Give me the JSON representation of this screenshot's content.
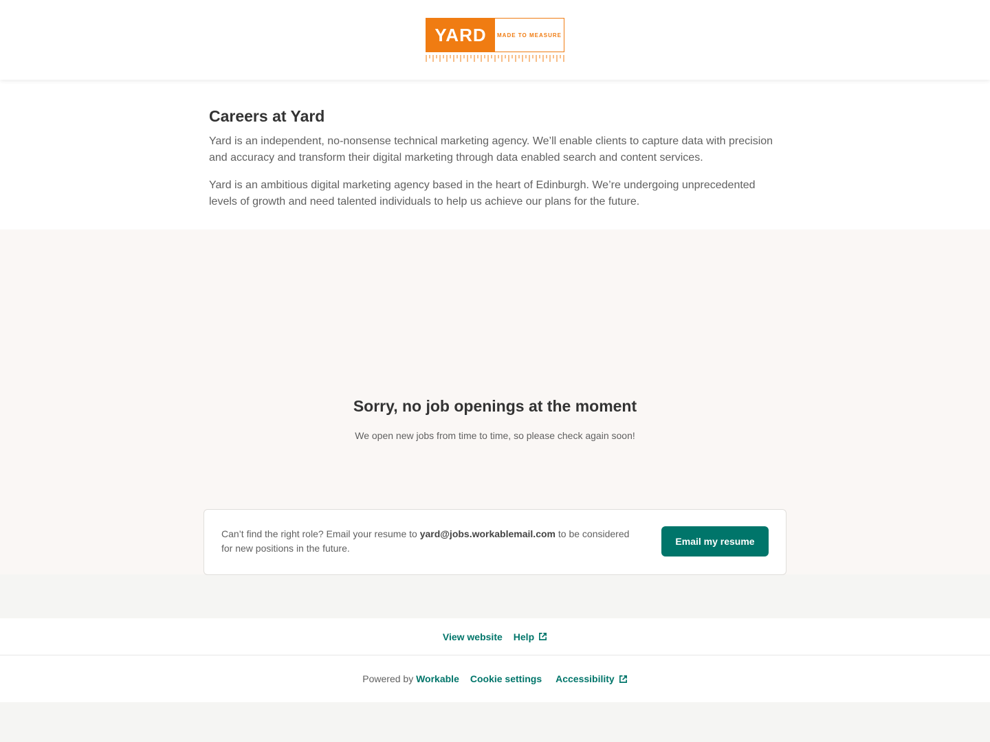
{
  "brand": {
    "logo_main": "YARD",
    "logo_tag": "MADE TO MEASURE",
    "accent": "#f07c12"
  },
  "intro": {
    "title": "Careers at Yard",
    "paragraphs": [
      "Yard is an independent, no-nonsense technical marketing agency. We’ll enable clients to capture data with precision and accuracy and transform their digital marketing through data enabled search and content services.",
      "Yard is an ambitious digital marketing agency based in the heart of Edinburgh. We’re undergoing unprecedented levels of growth and need talented individuals to help us achieve our plans for the future."
    ]
  },
  "jobs": {
    "empty_title": "Sorry, no job openings at the moment",
    "empty_subtitle": "We open new jobs from time to time, so please check again soon!"
  },
  "resume": {
    "text_before": "Can’t find the right role? Email your resume to ",
    "email": "yard@jobs.workablemail.com",
    "text_after": " to be considered for new positions in the future.",
    "button_label": "Email my resume",
    "button_color": "#00756a"
  },
  "footer": {
    "view_website": "View website",
    "help": "Help",
    "powered_by": "Powered by",
    "workable": "Workable",
    "cookie_settings": "Cookie settings",
    "accessibility": "Accessibility",
    "link_color": "#00756a"
  }
}
